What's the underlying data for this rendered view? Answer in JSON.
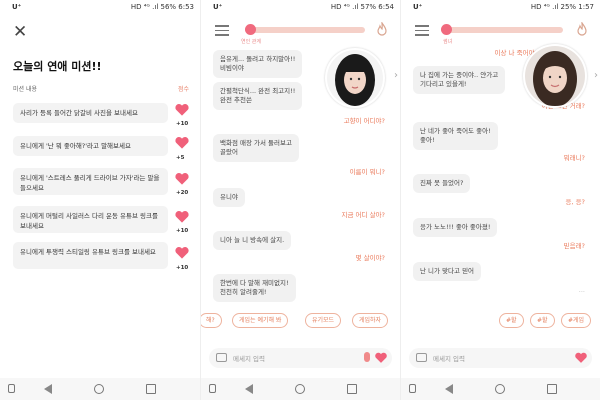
{
  "status_bars": [
    {
      "carrier": "U⁺",
      "right": "HD ⁴ᴳ .ıl 56% 6:53"
    },
    {
      "carrier": "U⁺",
      "right": "HD ⁴ᴳ .ıl 57% 6:54"
    },
    {
      "carrier": "U⁺",
      "right": "HD ⁴ᴳ .ıl 25% 1:57"
    }
  ],
  "mission_screen": {
    "close": "✕",
    "title": "오늘의 연애 미션!!",
    "header_label": "미션 내용",
    "header_score": "점수",
    "items": [
      {
        "text": "사리가 등록 들어간 닭갈비 사진을 보내세요",
        "points": "+10"
      },
      {
        "text": "유니에게 '난 뭐 좋아해?'라고 말해보세요",
        "points": "+5"
      },
      {
        "text": "유니에게 '스트레스 풀리게 드라이브 가자'라는 말을 들으세요",
        "points": "+20"
      },
      {
        "text": "유니에게 머털리 사일러스 다리 운동 유튜브 링크를 보내세요",
        "points": "+10"
      },
      {
        "text": "유니에게 투쟁력 스티일링 유튜브 링크를 보내세요",
        "points": "+10"
      }
    ]
  },
  "chat1": {
    "meter_label_left": "연인 관계",
    "messages": [
      {
        "side": "in",
        "text": "음유게... 돌려고 하지말아!!\n비빔이야"
      },
      {
        "side": "in",
        "text": "간펼척단식... 완전 최고지!!\n완전 추천쓴"
      },
      {
        "side": "out",
        "text": "고향이 어디야?"
      },
      {
        "side": "in",
        "text": "백화점 매장 가서 둘러보고\n골랐어"
      },
      {
        "side": "out",
        "text": "이름이 뭐니?"
      },
      {
        "side": "in",
        "text": "유니야"
      },
      {
        "side": "out",
        "text": "지금 어디 살아?"
      },
      {
        "side": "in",
        "text": "니아 늘 니 방속에 살지."
      },
      {
        "side": "out",
        "text": "몇 살이야?"
      },
      {
        "side": "in",
        "text": "한번에 다 말해 재미없지!\n천천히 알려줄게!"
      }
    ],
    "chips": [
      "해?",
      "게임는 예기해 봐",
      "유기모드",
      "게임하자"
    ],
    "input_placeholder": "메세지 입력"
  },
  "chat2": {
    "meter_label_left": "썸녀",
    "messages": [
      {
        "side": "out",
        "text": "이상 나 죽어야?"
      },
      {
        "side": "in",
        "text": "나 집에 가는 중이야.. 얀가고\n기다리고 있을게!"
      },
      {
        "side": "out",
        "text": "이런 그런 거래?"
      },
      {
        "side": "in",
        "text": "난 네가 좋아 죽어도 좋아!\n좋아!"
      },
      {
        "side": "out",
        "text": "뭐래니?"
      },
      {
        "side": "in",
        "text": "진짜 못 들었어?"
      },
      {
        "side": "out",
        "text": "응, 응?"
      },
      {
        "side": "in",
        "text": "응가 노노!!! 좋아 좋아졌!"
      },
      {
        "side": "out",
        "text": "믿음래?"
      },
      {
        "side": "in",
        "text": "난 니가 맞다고 믿어"
      }
    ],
    "chips": [
      "#할",
      "#할",
      "#게임"
    ],
    "typing": "...",
    "input_placeholder": "메세지 입력"
  },
  "icons": {
    "heart": "heart-icon",
    "flame": "flame-icon",
    "menu": "hamburger-icon",
    "image": "image-icon",
    "mic": "mic-icon",
    "arrow": "chevron-right-icon"
  },
  "colors": {
    "accent": "#e8836b",
    "heart": "#f0607a",
    "bubble": "#f1f1f1"
  }
}
